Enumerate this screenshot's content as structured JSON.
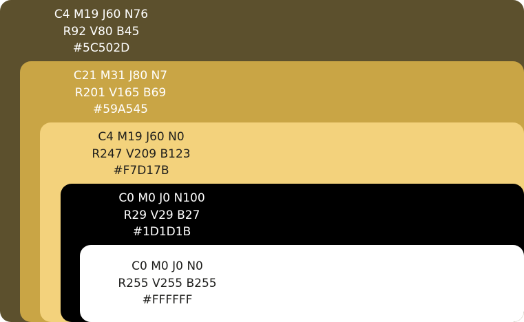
{
  "swatches": [
    {
      "cmyk": "C4 M19 J60 N76",
      "rgb": "R92 V80 B45",
      "hex": "#5C502D",
      "fill": "#5C502D",
      "text_color": "#FFFFFF"
    },
    {
      "cmyk": "C21 M31 J80 N7",
      "rgb": "R201 V165 B69",
      "hex": "#59A545",
      "fill": "#C9A545",
      "text_color": "#FFFFFF"
    },
    {
      "cmyk": "C4 M19 J60 N0",
      "rgb": "R247 V209 B123",
      "hex": "#F7D17B",
      "fill": "#F3D27C",
      "text_color": "#1D1D1B"
    },
    {
      "cmyk": "C0 M0 J0 N100",
      "rgb": "R29 V29 B27",
      "hex": "#1D1D1B",
      "fill": "#000000",
      "text_color": "#FFFFFF"
    },
    {
      "cmyk": "C0 M0 J0 N0",
      "rgb": "R255 V255 B255",
      "hex": "#FFFFFF",
      "fill": "#FFFFFF",
      "text_color": "#1D1D1B"
    }
  ]
}
